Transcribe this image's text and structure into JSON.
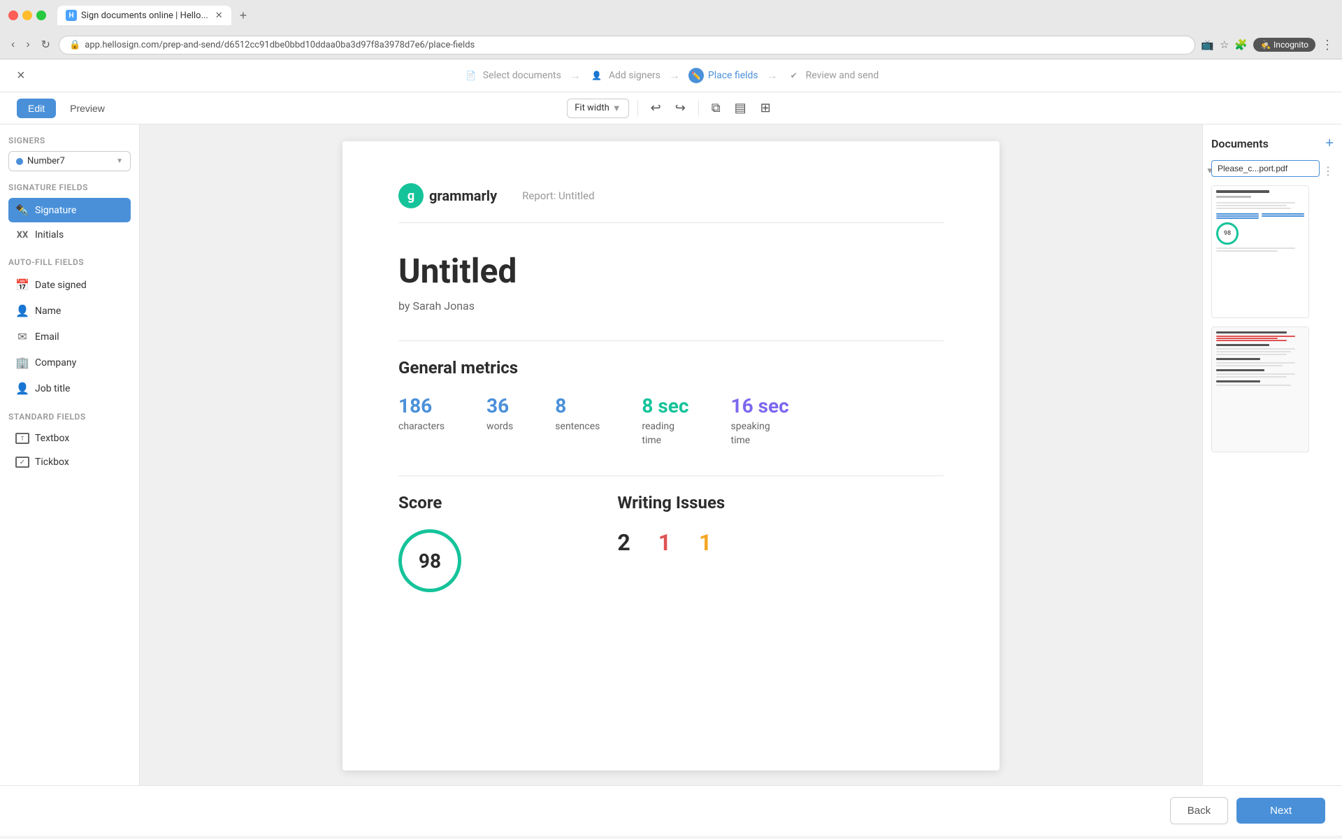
{
  "browser": {
    "tab_title": "Sign documents online | Hello...",
    "url": "app.hellosign.com/prep-and-send/d6512cc91dbe0bbd10ddaa0ba3d97f8a3978d7e6/place-fields",
    "incognito_label": "Incognito"
  },
  "wizard": {
    "close_label": "×",
    "steps": [
      {
        "id": "select-documents",
        "label": "Select documents",
        "icon": "📄",
        "active": false
      },
      {
        "id": "add-signers",
        "label": "Add signers",
        "icon": "👤",
        "active": false
      },
      {
        "id": "place-fields",
        "label": "Place fields",
        "icon": "✏️",
        "active": true
      },
      {
        "id": "review-and-send",
        "label": "Review and send",
        "icon": "✔",
        "active": false
      }
    ]
  },
  "toolbar": {
    "edit_label": "Edit",
    "preview_label": "Preview",
    "fit_width_label": "Fit width"
  },
  "sidebar": {
    "signers_section": "Signers",
    "signer_name": "Number7",
    "signature_fields_section": "Signature fields",
    "fields": [
      {
        "id": "signature",
        "label": "Signature",
        "active": true
      },
      {
        "id": "initials",
        "label": "Initials",
        "active": false
      }
    ],
    "autofill_section": "Auto-fill fields",
    "autofill_fields": [
      {
        "id": "date-signed",
        "label": "Date signed"
      },
      {
        "id": "name",
        "label": "Name"
      },
      {
        "id": "email",
        "label": "Email"
      },
      {
        "id": "company",
        "label": "Company"
      },
      {
        "id": "job-title",
        "label": "Job title"
      }
    ],
    "standard_section": "Standard fields",
    "standard_fields": [
      {
        "id": "textbox",
        "label": "Textbox"
      },
      {
        "id": "tickbox",
        "label": "Tickbox"
      }
    ]
  },
  "document": {
    "logo_letter": "G",
    "company_name": "grammarly",
    "report_label": "Report: Untitled",
    "title": "Untitled",
    "author": "by Sarah Jonas",
    "general_metrics_heading": "General metrics",
    "metrics": [
      {
        "id": "characters",
        "value": "186",
        "label": "characters",
        "color": "blue"
      },
      {
        "id": "words",
        "value": "36",
        "label": "words",
        "color": "blue"
      },
      {
        "id": "sentences",
        "value": "8",
        "label": "sentences",
        "color": "blue"
      },
      {
        "id": "reading-time",
        "value": "8 sec",
        "label": "reading\ntime",
        "color": "teal"
      },
      {
        "id": "speaking-time",
        "value": "16 sec",
        "label": "speaking\ntime",
        "color": "purple"
      }
    ],
    "score_heading": "Score",
    "score_value": "98",
    "writing_issues_heading": "Writing Issues",
    "writing_numbers": [
      {
        "value": "2",
        "color": "dark"
      },
      {
        "value": "1",
        "color": "red"
      },
      {
        "value": "1",
        "color": "orange"
      }
    ]
  },
  "right_sidebar": {
    "title": "Documents",
    "filename": "Please_c...port.pdf"
  },
  "footer": {
    "back_label": "Back",
    "next_label": "Next"
  }
}
